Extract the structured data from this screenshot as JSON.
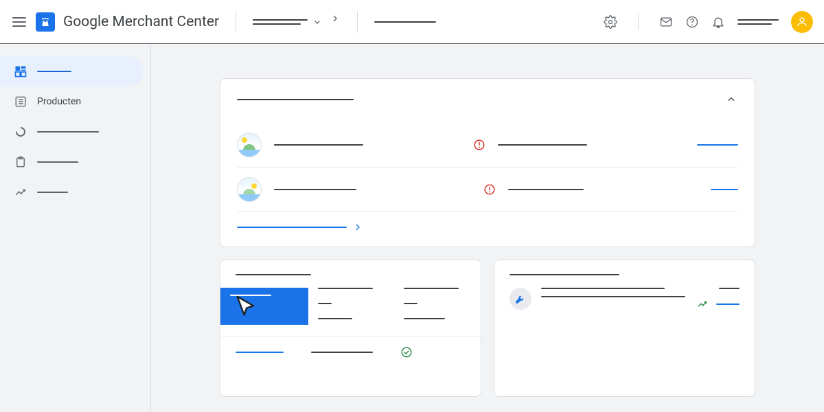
{
  "header": {
    "app_title": "Google Merchant Center",
    "dropdown_label": "",
    "breadcrumb": "",
    "account_label": ""
  },
  "sidebar": {
    "items": [
      {
        "label": "",
        "active": true
      },
      {
        "label": "Producten",
        "active": false
      },
      {
        "label": "",
        "active": false
      },
      {
        "label": "",
        "active": false
      },
      {
        "label": "",
        "active": false
      }
    ]
  },
  "card1": {
    "title": "",
    "rows": [
      {
        "name": "",
        "status": "",
        "action": ""
      },
      {
        "name": "",
        "status": "",
        "action": ""
      }
    ],
    "footer_link": ""
  },
  "card2": {
    "title": "",
    "col1": [
      "",
      ""
    ],
    "col2": [
      "",
      ""
    ],
    "footer_link": "",
    "footer_text": ""
  },
  "card3": {
    "title": "",
    "item_line1": "",
    "item_line2": "",
    "meta": "",
    "action": ""
  },
  "colors": {
    "primary": "#1a73e8",
    "danger": "#d93025",
    "success": "#188038",
    "accent": "#fbbc04"
  }
}
